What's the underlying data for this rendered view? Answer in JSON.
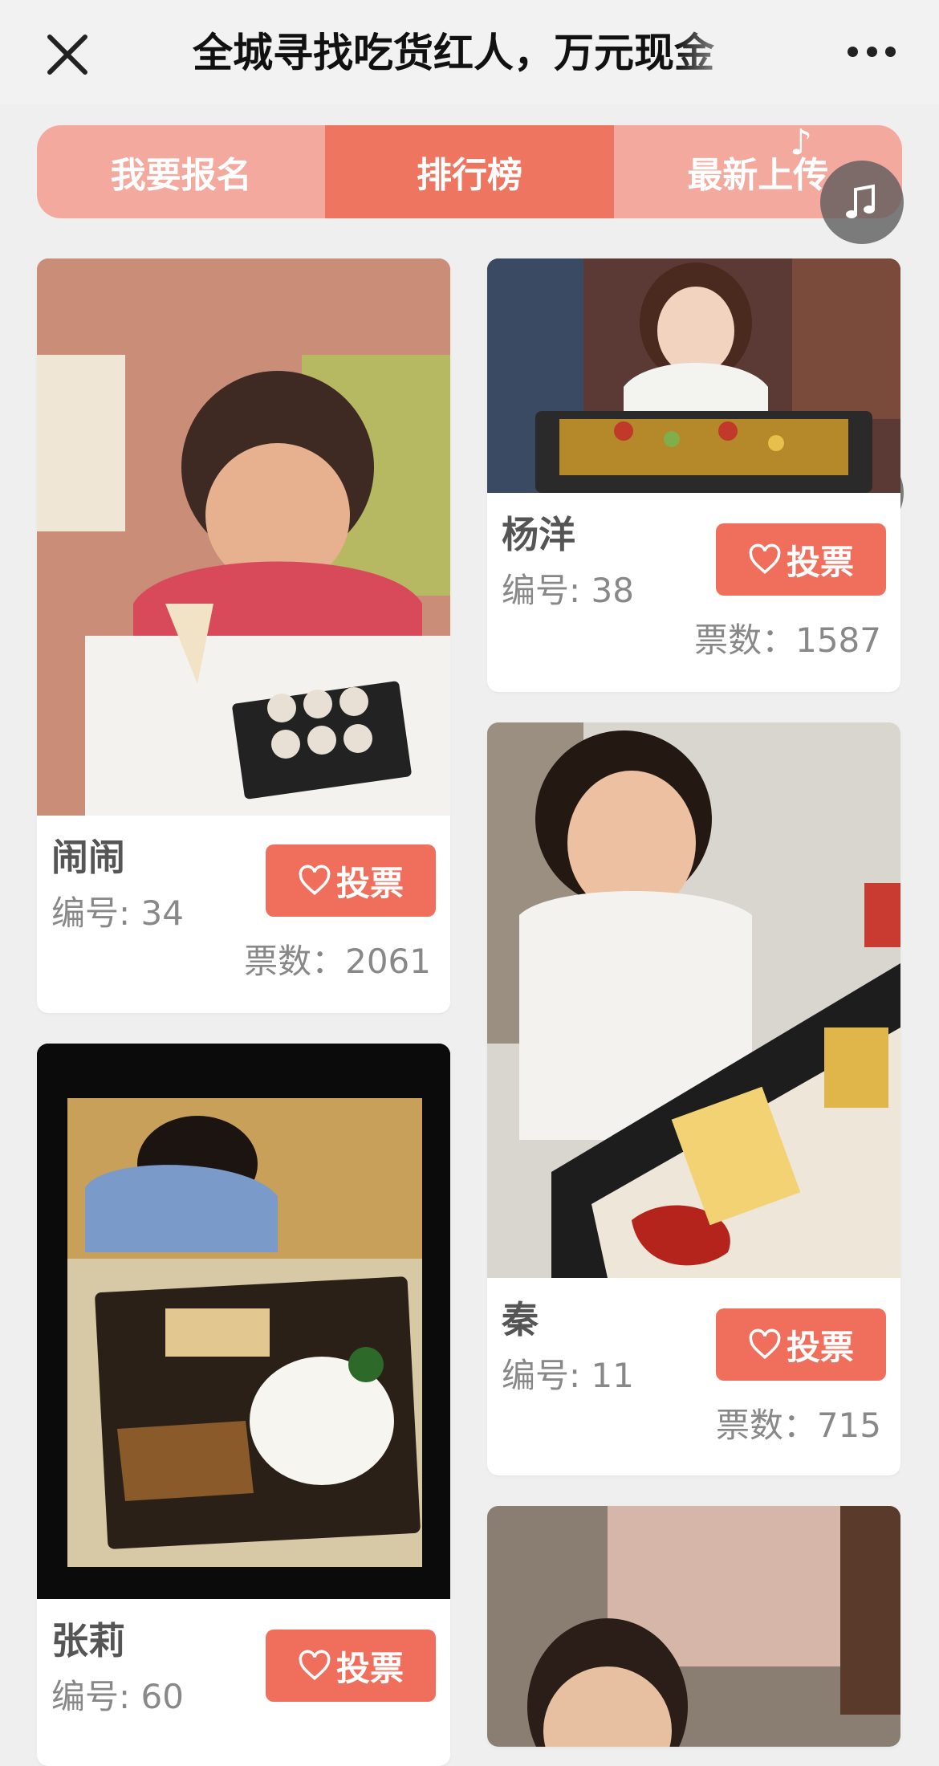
{
  "header": {
    "title": "全城寻找吃货红人，万元现金"
  },
  "tabs": [
    {
      "label": "我要报名",
      "active": false
    },
    {
      "label": "排行榜",
      "active": true
    },
    {
      "label": "最新上传",
      "active": false
    }
  ],
  "colors": {
    "accent": "#ef6f5c",
    "tab_bg": "#f3a99e",
    "tab_active": "#ee7560"
  },
  "floating_icons": [
    "music-note-icon",
    "share-icon",
    "warning-icon"
  ],
  "entries": [
    {
      "name": "闹闹",
      "number_label": "编号: 34",
      "votes_label": "票数：2061",
      "vote_label": "投票"
    },
    {
      "name": "杨洋",
      "number_label": "编号: 38",
      "votes_label": "票数：1587",
      "vote_label": "投票"
    },
    {
      "name": "张莉",
      "number_label": "编号: 60",
      "votes_label": "",
      "vote_label": "投票"
    },
    {
      "name": "秦",
      "number_label": "编号: 11",
      "votes_label": "票数：715",
      "vote_label": "投票"
    }
  ]
}
